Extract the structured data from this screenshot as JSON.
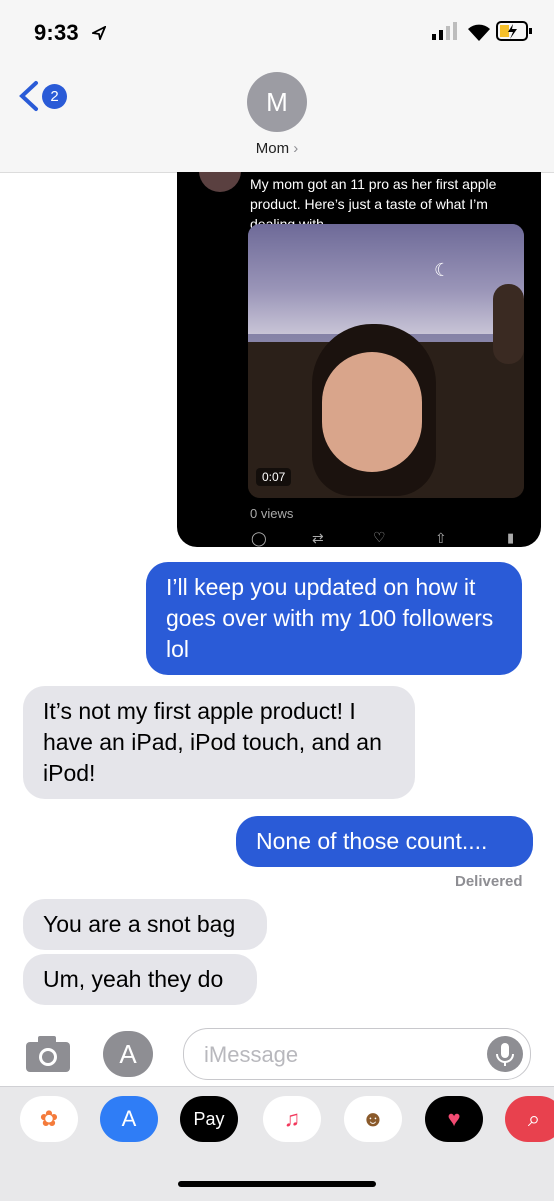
{
  "status_bar": {
    "time": "9:33"
  },
  "header": {
    "back_count": "2",
    "avatar_initial": "M",
    "contact_name": "Mom"
  },
  "tweet": {
    "text_partial": "My mom got an 11 pro as her first apple product. Here’s just a taste of what I’m dealing with...",
    "video_duration": "0:07",
    "views": "0 views"
  },
  "messages": [
    {
      "direction": "outgoing",
      "text": "I’ll keep you updated on how it goes over with my 100 followers lol"
    },
    {
      "direction": "incoming",
      "text": "It’s not my first apple product! I have an iPad, iPod touch, and an iPod!"
    },
    {
      "direction": "outgoing",
      "text": "None of those count...."
    },
    {
      "direction": "incoming",
      "text": "You are a snot bag"
    },
    {
      "direction": "incoming",
      "text": "Um, yeah they do"
    }
  ],
  "delivered_label": "Delivered",
  "compose": {
    "placeholder": "iMessage"
  },
  "app_drawer": {
    "apple_pay_label": "Pay",
    "apps": [
      "photos-icon",
      "app-store-icon",
      "apple-pay-icon",
      "music-icon",
      "animoji-icon",
      "digital-touch-icon",
      "search-images-icon"
    ]
  },
  "colors": {
    "outgoing_bubble": "#2a5bd7",
    "incoming_bubble": "#e5e5ea"
  }
}
